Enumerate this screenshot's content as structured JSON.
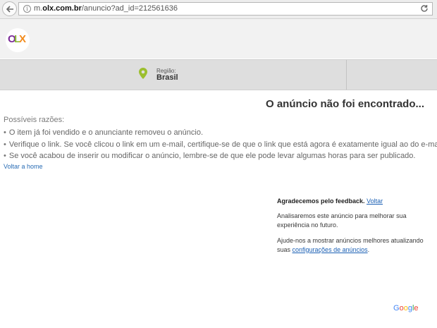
{
  "browser": {
    "url_prefix": "m.",
    "url_domain": "olx.com.br",
    "url_path": "/anuncio?ad_id=212561636"
  },
  "header": {
    "logo": {
      "o": "O",
      "l": "L",
      "x": "X"
    },
    "region_label": "Região:",
    "region_value": "Brasil"
  },
  "main": {
    "title": "O anúncio não foi encontrado...",
    "reasons_heading": "Possíveis razões:",
    "reasons": [
      "O item já foi vendido e o anunciante removeu o anúncio.",
      "Verifique o link. Se você clicou o link em um e-mail, certifique-se de que o link que está agora é exatamente igual ao do e-mail.",
      "Se você acabou de inserir ou modificar o anúncio, lembre-se de que ele pode levar algumas horas para ser publicado."
    ],
    "back_home": "Voltar a home"
  },
  "feedback": {
    "title": "Agradecemos pelo feedback.",
    "undo": "Voltar",
    "p1": "Analisaremos este anúncio para melhorar sua experiência no futuro.",
    "p2_text": "Ajude-nos a mostrar anúncios melhores atualizando suas",
    "p2_link": "configurações de anúncios",
    "p2_end": ".",
    "brand": {
      "g1": "G",
      "g2": "o",
      "g3": "o",
      "g4": "g",
      "g5": "l",
      "g6": "e"
    }
  },
  "colors": {
    "link": "#2a6db5",
    "olx_purple": "#7b2a97",
    "olx_green": "#8cb93a",
    "olx_orange": "#f28a1a"
  }
}
